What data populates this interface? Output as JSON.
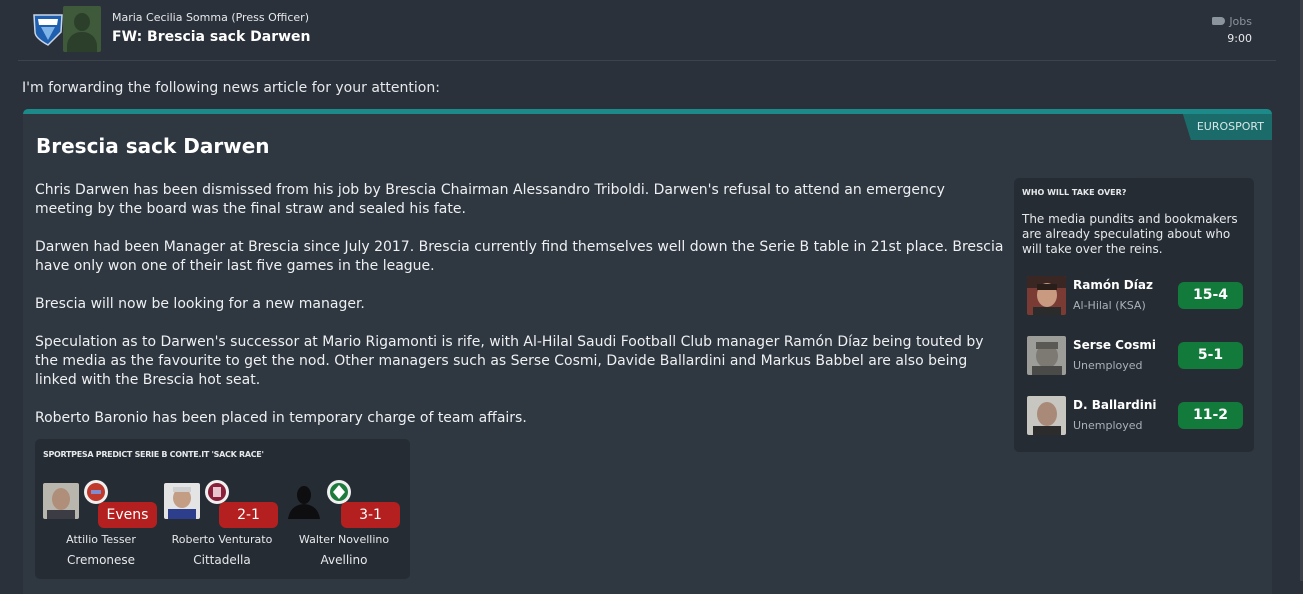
{
  "header": {
    "sender": "Maria Cecilia Somma  (Press Officer)",
    "subject": "FW: Brescia sack Darwen",
    "jobs_label": "Jobs",
    "time": "9:00"
  },
  "intro": "I'm forwarding the following news article for your attention:",
  "article": {
    "source": "EUROSPORT",
    "headline": "Brescia sack Darwen",
    "paragraphs": [
      "Chris Darwen has been dismissed from his job by Brescia Chairman Alessandro Triboldi. Darwen's refusal to attend an emergency meeting by the board was the final straw and sealed his fate.",
      "Darwen had been Manager at Brescia since July 2017. Brescia currently find themselves well down the Serie B table in 21st place. Brescia have only won one of their last five games in the league.",
      "Brescia will now be looking for a new manager.",
      "Speculation as to Darwen's successor at Mario Rigamonti is rife, with Al-Hilal Saudi Football Club manager Ramón Díaz being touted by the media as the favourite to get the nod. Other managers such as Serse Cosmi, Davide Ballardini and Markus Babbel are also being linked with the Brescia hot seat.",
      "Roberto Baronio has been placed in temporary charge of team affairs."
    ]
  },
  "takeover": {
    "title": "WHO WILL TAKE OVER?",
    "description": "The media pundits and bookmakers are already speculating about who will take over the reins.",
    "candidates": [
      {
        "name": "Ramón Díaz",
        "club": "Al-Hilal (KSA)",
        "odds": "15-4"
      },
      {
        "name": "Serse Cosmi",
        "club": "Unemployed",
        "odds": "5-1"
      },
      {
        "name": "D. Ballardini",
        "club": "Unemployed",
        "odds": "11-2"
      }
    ]
  },
  "sack_race": {
    "title": "SPORTPESA PREDICT SERIE B CONTE.IT 'SACK RACE'",
    "managers": [
      {
        "name": "Attilio Tesser",
        "club": "Cremonese",
        "odds": "Evens"
      },
      {
        "name": "Roberto Venturato",
        "club": "Cittadella",
        "odds": "2-1"
      },
      {
        "name": "Walter Novellino",
        "club": "Avellino",
        "odds": "3-1"
      }
    ]
  },
  "colors": {
    "background": "#2b313a",
    "panel": "#2f3740",
    "accent_teal": "#1b8a88",
    "odds_green": "#127a3a",
    "odds_red": "#b3201f"
  }
}
